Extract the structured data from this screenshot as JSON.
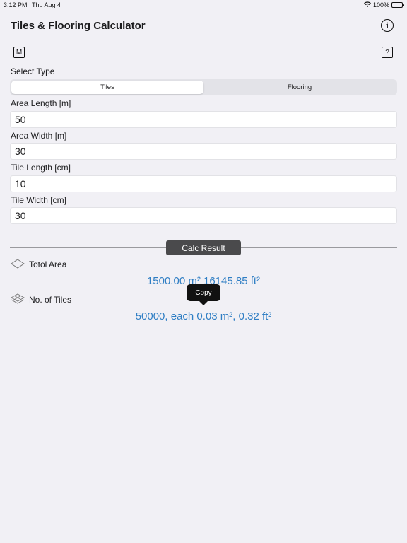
{
  "status_bar": {
    "time": "3:12 PM",
    "date": "Thu Aug 4",
    "battery": "100%"
  },
  "nav": {
    "title": "Tiles & Flooring Calculator"
  },
  "buttons": {
    "info": "i",
    "m": "M",
    "help": "?"
  },
  "select_type": {
    "label": "Select Type",
    "options": [
      "Tiles",
      "Flooring"
    ],
    "selected": "Tiles"
  },
  "fields": [
    {
      "label": "Area Length [m]",
      "value": "50"
    },
    {
      "label": "Area Width [m]",
      "value": "30"
    },
    {
      "label": "Tile Length [cm]",
      "value": "10"
    },
    {
      "label": "Tile Width [cm]",
      "value": "30"
    }
  ],
  "calc_button": "Calc Result",
  "results": {
    "total_area_label": "Totol Area",
    "total_area_value": "1500.00 m² 16145.85 ft²",
    "tiles_label": "No. of Tiles",
    "tiles_value": "50000, each 0.03 m², 0.32 ft²"
  },
  "tooltip": "Copy",
  "colors": {
    "accent": "#2f7ec4",
    "background": "#f1f0f5",
    "button_dark": "#4a4a4c"
  }
}
